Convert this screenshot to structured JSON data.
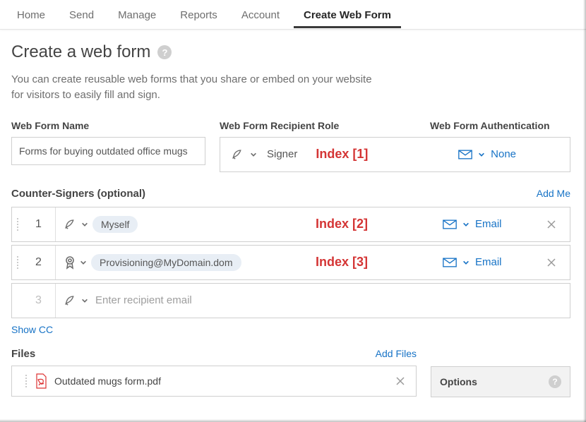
{
  "nav": {
    "items": [
      {
        "label": "Home",
        "active": false
      },
      {
        "label": "Send",
        "active": false
      },
      {
        "label": "Manage",
        "active": false
      },
      {
        "label": "Reports",
        "active": false
      },
      {
        "label": "Account",
        "active": false
      },
      {
        "label": "Create Web Form",
        "active": true
      }
    ]
  },
  "page": {
    "title": "Create a web form",
    "help_tooltip": "?",
    "description": "You can create reusable web forms that you share or embed on your website for visitors to easily fill and sign."
  },
  "fields": {
    "name": {
      "label": "Web Form Name",
      "value": "Forms for buying outdated office mugs"
    },
    "role": {
      "label": "Web Form Recipient Role",
      "value": "Signer",
      "annotation": "Index [1]"
    },
    "auth": {
      "label": "Web Form Authentication",
      "value": "None"
    }
  },
  "counter_signers": {
    "label": "Counter-Signers (optional)",
    "add_me": "Add Me",
    "rows": [
      {
        "num": "1",
        "chip": "Myself",
        "role_icon": "pen",
        "annotation": "Index [2]",
        "auth_value": "Email"
      },
      {
        "num": "2",
        "chip": "Provisioning@MyDomain.dom",
        "role_icon": "ribbon",
        "annotation": "Index [3]",
        "auth_value": "Email"
      }
    ],
    "blank": {
      "num": "3",
      "placeholder": "Enter recipient email"
    },
    "show_cc": "Show CC"
  },
  "files": {
    "label": "Files",
    "add_files": "Add Files",
    "items": [
      {
        "name": "Outdated mugs form.pdf"
      }
    ]
  },
  "options": {
    "title": "Options",
    "help": "?"
  },
  "icons": {
    "pen": "pen-icon",
    "chevron": "chevron-down-icon",
    "mail": "mail-icon",
    "ribbon": "ribbon-icon",
    "close": "close-icon",
    "pdf": "pdf-icon",
    "help": "help-icon"
  }
}
